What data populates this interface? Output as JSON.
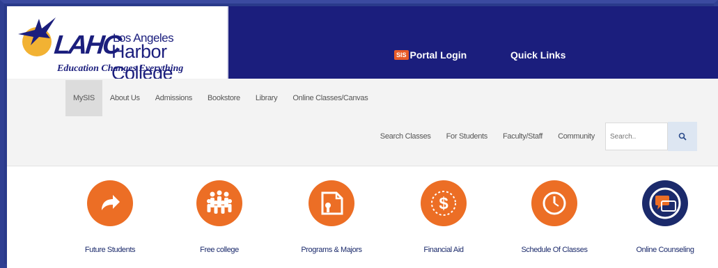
{
  "header": {
    "logo": {
      "abbrev": "LAHC",
      "line1": "Los Angeles",
      "line2": "Harbor College",
      "tagline": "Education Changes Everything"
    },
    "portal_badge": "SIS",
    "portal_label": "Portal Login",
    "quick_links": "Quick Links"
  },
  "nav": {
    "primary": [
      "MySIS",
      "About Us",
      "Admissions",
      "Bookstore",
      "Library",
      "Online Classes/Canvas"
    ],
    "secondary": [
      "Search Classes",
      "For Students",
      "Faculty/Staff",
      "Community"
    ],
    "search_placeholder": "Search.."
  },
  "tiles": [
    {
      "label": "Future Students",
      "icon": "share-arrow-icon"
    },
    {
      "label": "Free college",
      "icon": "people-group-icon"
    },
    {
      "label": "Programs & Majors",
      "icon": "document-person-icon"
    },
    {
      "label": "Financial Aid",
      "icon": "dollar-icon"
    },
    {
      "label": "Schedule Of Classes",
      "icon": "clock-icon"
    },
    {
      "label": "Online Counseling",
      "icon": "chat-bubble-icon"
    }
  ],
  "colors": {
    "header_bg": "#1b1e7d",
    "accent_orange": "#ec6e25",
    "navy": "#1b2a6b",
    "frame": "#2f3f92"
  }
}
